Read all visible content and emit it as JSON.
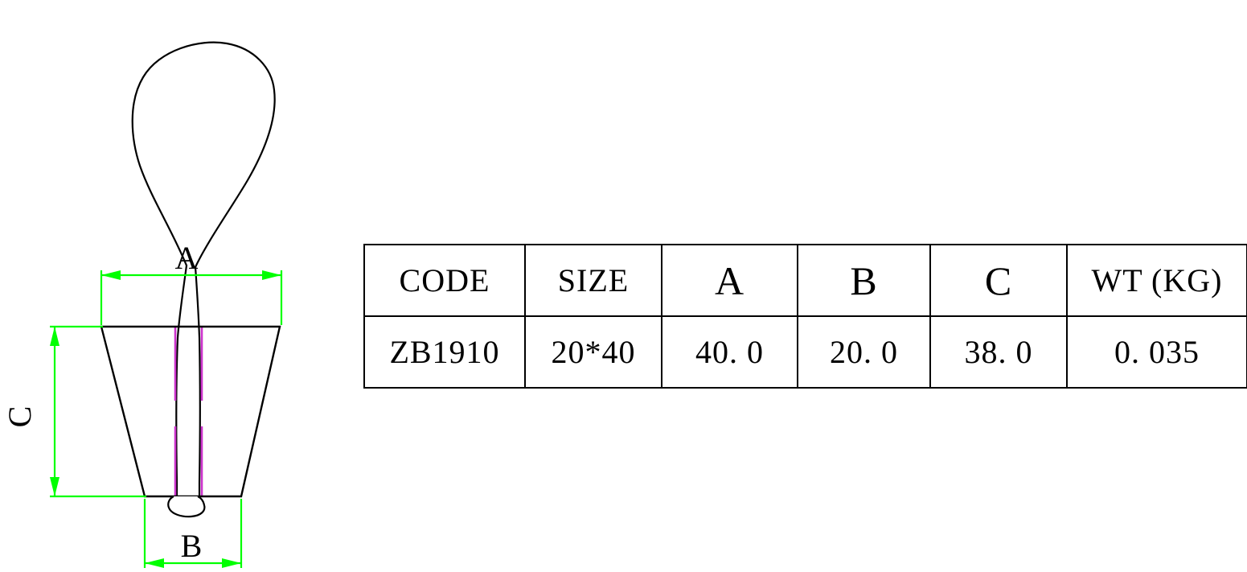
{
  "drawing": {
    "title": "Wire rope loop sleeve / tassel technical drawing",
    "dimension_labels": {
      "a": "A",
      "b": "B",
      "c": "C"
    },
    "colors": {
      "outline": "#000000",
      "dimension": "#00ff00",
      "hidden_line": "#cc33cc",
      "background": "#ffffff"
    }
  },
  "table": {
    "headers": [
      {
        "key": "code",
        "label": "CODE",
        "emphasis": false
      },
      {
        "key": "size",
        "label": "SIZE",
        "emphasis": false
      },
      {
        "key": "a",
        "label": "A",
        "emphasis": true
      },
      {
        "key": "b",
        "label": "B",
        "emphasis": true
      },
      {
        "key": "c",
        "label": "C",
        "emphasis": true
      },
      {
        "key": "wt",
        "label": "WT (KG)",
        "emphasis": false
      }
    ],
    "rows": [
      {
        "code": "ZB1910",
        "size": "20*40",
        "a": "40. 0",
        "b": "20. 0",
        "c": "38. 0",
        "wt": "0. 035"
      }
    ]
  }
}
